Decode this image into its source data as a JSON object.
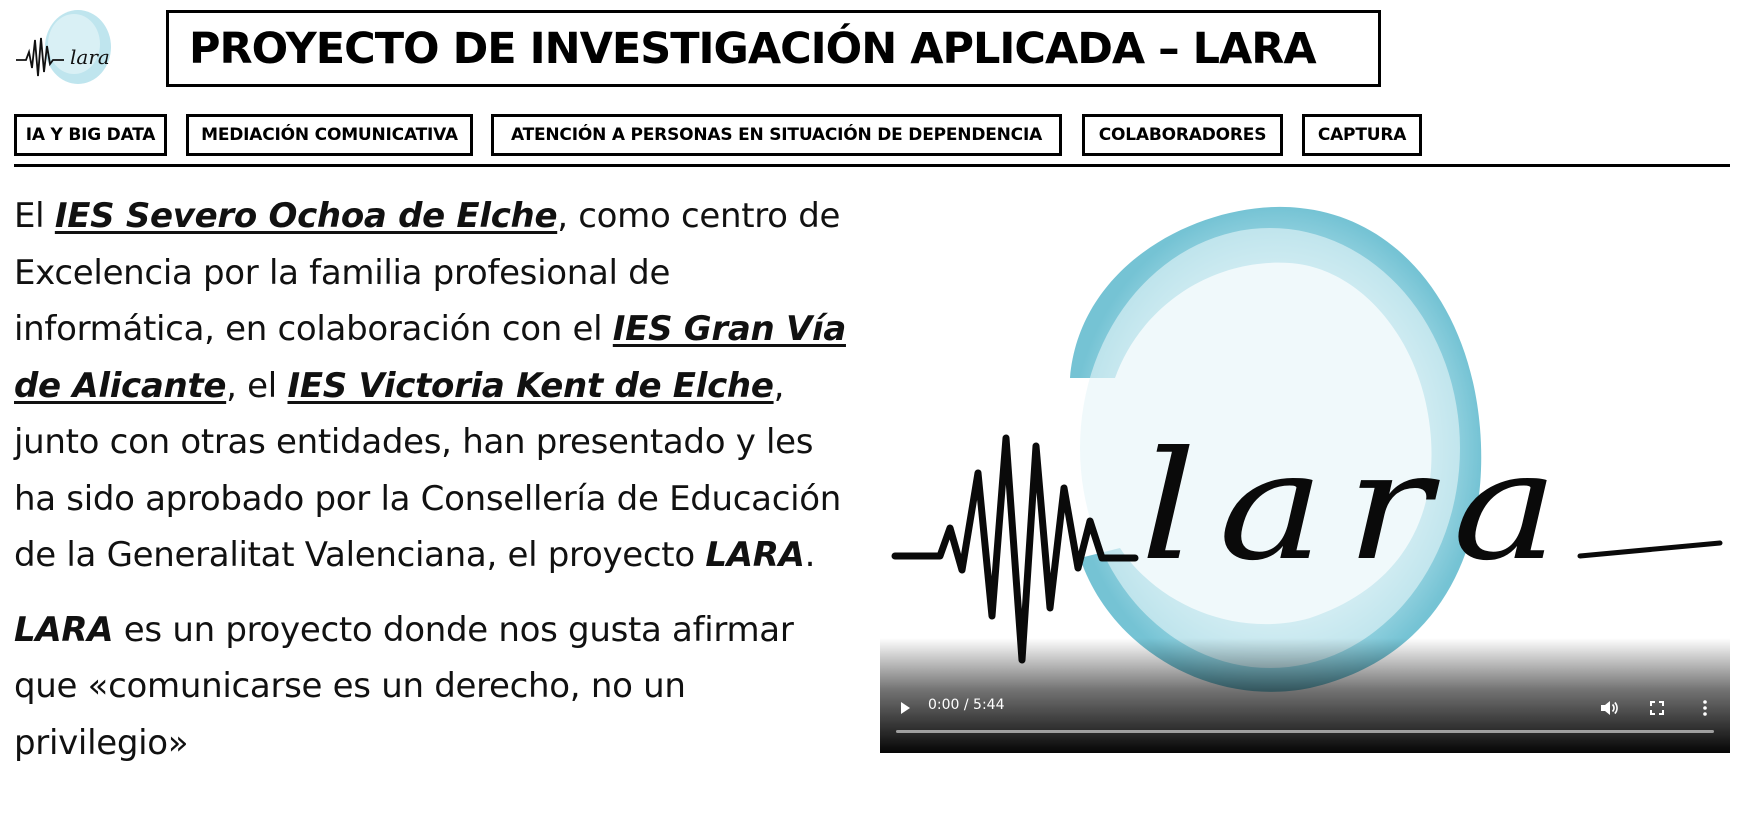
{
  "header": {
    "logo_label": "lara-logo",
    "title": "PROYECTO DE INVESTIGACIÓN APLICADA – LARA"
  },
  "nav": {
    "items": [
      {
        "label": "IA Y BIG DATA"
      },
      {
        "label": "MEDIACIÓN COMUNICATIVA"
      },
      {
        "label": "ATENCIÓN A PERSONAS EN SITUACIÓN DE DEPENDENCIA"
      },
      {
        "label": "COLABORADORES"
      },
      {
        "label": "CAPTURA"
      }
    ]
  },
  "article": {
    "p1": {
      "t1": "El ",
      "link1": "IES Severo Ochoa de Elche",
      "t2": ", como centro de Excelencia por la familia profesional de informática, en colaboración con el ",
      "link2": "IES Gran Vía de Alicante",
      "t3": ", el ",
      "link3": "IES Victoria Kent de Elche",
      "t4": ", junto con otras entidades, han presentado y les ha sido aprobado por la Consellería de Educación de la Generalitat Valenciana, el proyecto ",
      "em1": "LARA",
      "t5": "."
    },
    "p2": {
      "em1": "LARA",
      "t1": " es un proyecto donde nos gusta afirmar que «comunicarse es un derecho, no un privilegio»"
    }
  },
  "video": {
    "poster_text": "lara",
    "time": "0:00 / 5:44",
    "progress": 0,
    "icons": [
      "play-icon",
      "volume-icon",
      "fullscreen-icon",
      "more-options-icon"
    ]
  },
  "colors": {
    "watercolor": "#7cc6d6",
    "text": "#111111",
    "border": "#000000"
  }
}
